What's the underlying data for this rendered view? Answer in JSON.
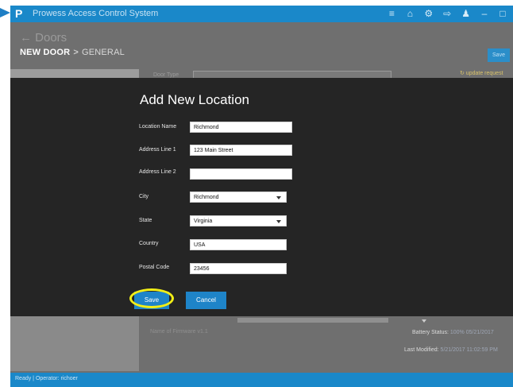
{
  "app": {
    "title": "Prowess Access Control System",
    "logo": "P",
    "titlebar_icons": [
      "menu-icon",
      "home-icon",
      "gear-icon",
      "logout-icon",
      "user-icon",
      "minimize-icon",
      "maximize-icon"
    ]
  },
  "page": {
    "back_label": "← Doors",
    "breadcrumb_main": "NEW DOOR",
    "breadcrumb_sep": ">",
    "breadcrumb_sub": "GENERAL",
    "save_label": "Save",
    "door_type_label": "Door Type",
    "update_link": "↻ update request"
  },
  "modal": {
    "title": "Add New Location",
    "fields": {
      "location_name": {
        "label": "Location Name",
        "value": "Richmond"
      },
      "address1": {
        "label": "Address Line 1",
        "value": "123 Main Street"
      },
      "address2": {
        "label": "Address Line 2",
        "value": ""
      },
      "city": {
        "label": "City",
        "value": "Richmond"
      },
      "state": {
        "label": "State",
        "value": "Virginia"
      },
      "country": {
        "label": "Country",
        "value": "USA"
      },
      "postal": {
        "label": "Postal Code",
        "value": "23456"
      }
    },
    "save_label": "Save",
    "cancel_label": "Cancel"
  },
  "footer_info": {
    "firmware": "Name of Firmware v1.1",
    "battery_label": "Battery Status:",
    "battery_value": "100% 05/21/2017",
    "modified_label": "Last Modified:",
    "modified_value": "5/21/2017 11:02:59 PM"
  },
  "status": {
    "text": "Ready | Operator: richoer"
  },
  "colors": {
    "accent": "#1a88c9",
    "highlight": "#f2ee16",
    "modal_bg": "#252525"
  }
}
